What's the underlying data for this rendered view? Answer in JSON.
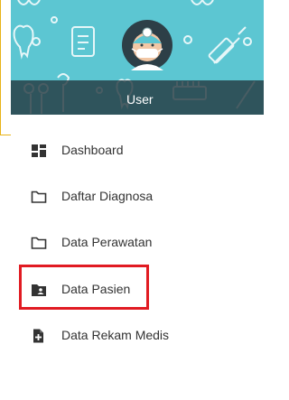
{
  "header": {
    "user_label": "User",
    "background_color": "#5cc6d2",
    "avatar_icon": "dentist-icon"
  },
  "menu": {
    "items": [
      {
        "label": "Dashboard",
        "icon": "dashboard-icon"
      },
      {
        "label": "Daftar Diagnosa",
        "icon": "folder-outline-icon"
      },
      {
        "label": "Data Perawatan",
        "icon": "folder-outline-icon"
      },
      {
        "label": "Data Pasien",
        "icon": "folder-account-icon"
      },
      {
        "label": "Data Rekam Medis",
        "icon": "file-plus-icon"
      }
    ],
    "highlight_color": "#e11b22"
  }
}
